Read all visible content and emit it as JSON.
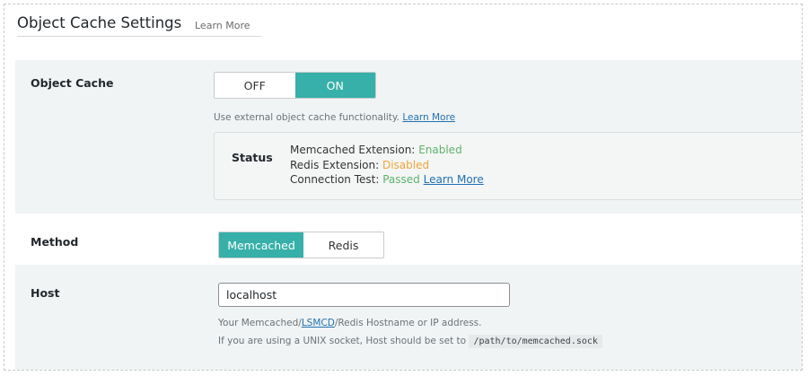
{
  "header": {
    "title": "Object Cache Settings",
    "learn_more": "Learn More"
  },
  "object_cache": {
    "label": "Object Cache",
    "toggle": {
      "off": "OFF",
      "on": "ON",
      "selected": "ON"
    },
    "description": "Use external object cache functionality.",
    "description_link": "Learn More",
    "status": {
      "label": "Status",
      "lines": [
        {
          "name": "Memcached Extension:",
          "value": "Enabled",
          "color": "#5db26b"
        },
        {
          "name": "Redis Extension:",
          "value": "Disabled",
          "color": "#f0a438"
        },
        {
          "name": "Connection Test:",
          "value": "Passed",
          "color": "#5db26b",
          "link": "Learn More"
        }
      ]
    }
  },
  "method": {
    "label": "Method",
    "options": [
      "Memcached",
      "Redis"
    ],
    "selected": "Memcached"
  },
  "host": {
    "label": "Host",
    "value": "localhost",
    "hint_before": "Your Memcached/",
    "hint_link": "LSMCD",
    "hint_after": "/Redis Hostname or IP address.",
    "socket_hint": "If you are using a UNIX socket, Host should be set to",
    "socket_path": "/path/to/memcached.sock"
  },
  "colors": {
    "accent": "#36b0a9",
    "link": "#2271b1",
    "row_background": "#f1f4f4"
  }
}
